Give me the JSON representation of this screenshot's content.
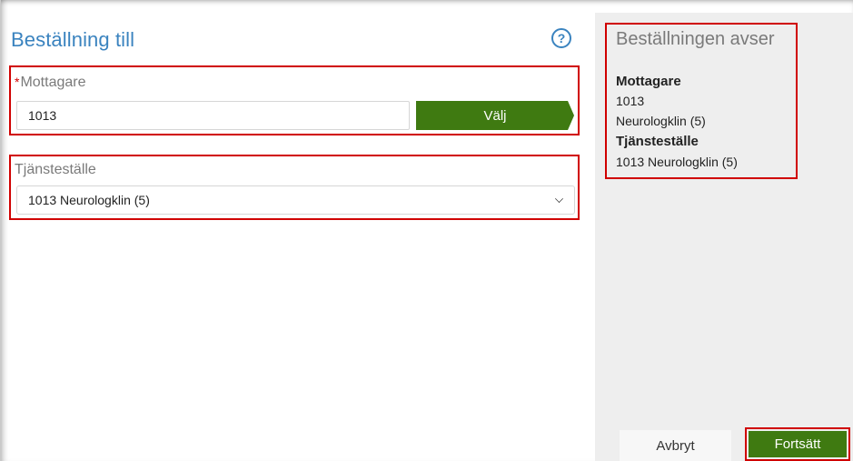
{
  "header": {
    "title": "Beställning till",
    "help_icon": "?"
  },
  "mottagare": {
    "required_mark": "*",
    "label": "Mottagare",
    "value": "1013",
    "choose_button": "Välj"
  },
  "tjanstestalle": {
    "label": "Tjänsteställe",
    "selected": "1013 Neurologklin (5)"
  },
  "summary": {
    "title": "Beställningen avser",
    "mottagare_heading": "Mottagare",
    "mottagare_line1": "1013",
    "mottagare_line2": "Neurologklin (5)",
    "tjanstestalle_heading": "Tjänsteställe",
    "tjanstestalle_value": "1013 Neurologklin (5)"
  },
  "footer": {
    "cancel_label": "Avbryt",
    "continue_label": "Fortsätt"
  },
  "colors": {
    "accent_blue": "#3a83bf",
    "button_green": "#3f7a11",
    "highlight_red": "#d00000",
    "sidebar_gray": "#eeeeee"
  }
}
